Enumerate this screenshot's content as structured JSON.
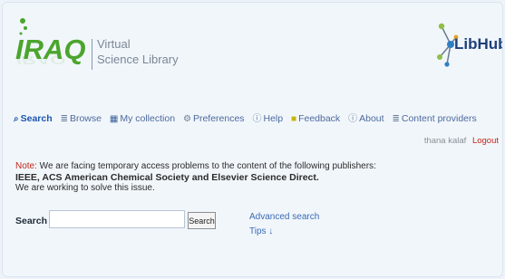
{
  "header": {
    "logo_main": "IRAQ",
    "logo_sub_line1": "Virtual",
    "logo_sub_line2": "Science Library",
    "partner_logo": "LibHub"
  },
  "nav": {
    "items": [
      {
        "label": "Search",
        "icon": "magnifier-icon",
        "active": true
      },
      {
        "label": "Browse",
        "icon": "list-icon"
      },
      {
        "label": "My collection",
        "icon": "books-icon"
      },
      {
        "label": "Preferences",
        "icon": "gear-icon"
      },
      {
        "label": "Help",
        "icon": "help-icon"
      },
      {
        "label": "Feedback",
        "icon": "feedback-icon"
      },
      {
        "label": "About",
        "icon": "info-icon"
      },
      {
        "label": "Content providers",
        "icon": "list-icon"
      }
    ]
  },
  "user": {
    "name": "thana kalaf",
    "logout_label": "Logout"
  },
  "notice": {
    "label": "Note:",
    "line1": " We are facing temporary access problems to the content of the following publishers:",
    "line2": "IEEE, ACS American Chemical Society and Elsevier Science Direct.",
    "line3": "We are working to solve this issue."
  },
  "search": {
    "label": "Search",
    "input_value": "",
    "button_label": "Search",
    "advanced_label": "Advanced search",
    "tips_label": "Tips ↓"
  },
  "colors": {
    "accent_green": "#4ba52d",
    "link_blue": "#3a6bb5",
    "note_red": "#c4261b",
    "background": "#f1f6fb"
  }
}
